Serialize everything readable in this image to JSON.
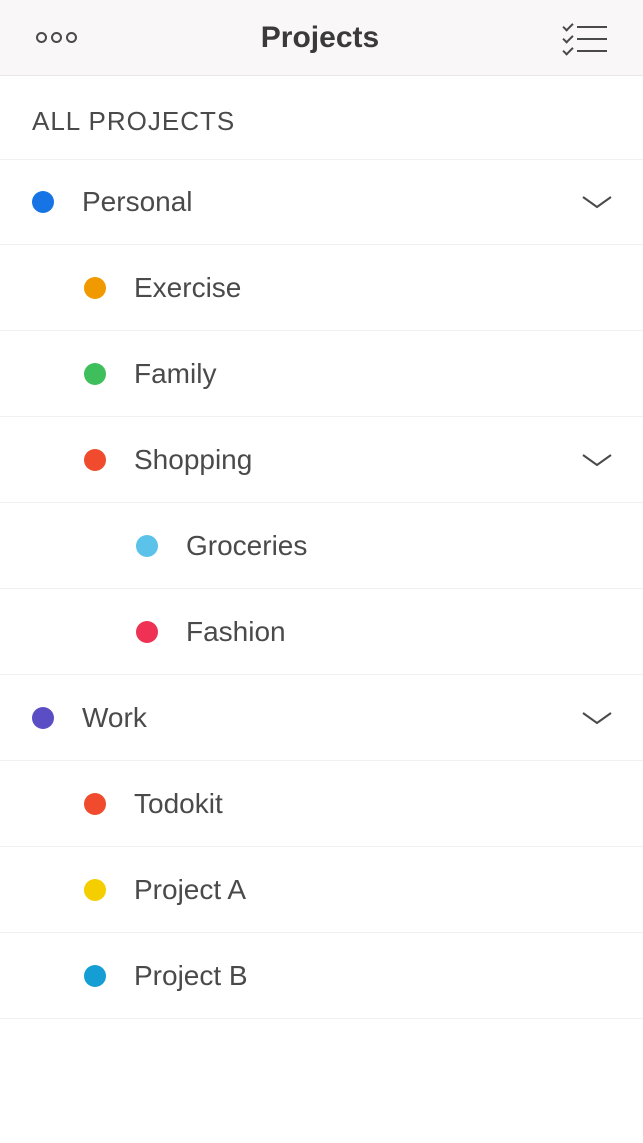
{
  "header": {
    "title": "Projects"
  },
  "sectionTitle": "ALL PROJECTS",
  "projects": [
    {
      "label": "Personal",
      "color": "#1674e5",
      "level": 0,
      "expandable": true
    },
    {
      "label": "Exercise",
      "color": "#f09a00",
      "level": 1,
      "expandable": false
    },
    {
      "label": "Family",
      "color": "#3fbf5c",
      "level": 1,
      "expandable": false
    },
    {
      "label": "Shopping",
      "color": "#ef4b2c",
      "level": 1,
      "expandable": true
    },
    {
      "label": "Groceries",
      "color": "#5bc3ea",
      "level": 2,
      "expandable": false
    },
    {
      "label": "Fashion",
      "color": "#ef3254",
      "level": 2,
      "expandable": false
    },
    {
      "label": "Work",
      "color": "#5b4ec5",
      "level": 0,
      "expandable": true
    },
    {
      "label": "Todokit",
      "color": "#ef4b2c",
      "level": 1,
      "expandable": false
    },
    {
      "label": "Project A",
      "color": "#f5ce00",
      "level": 1,
      "expandable": false
    },
    {
      "label": "Project B",
      "color": "#159ed4",
      "level": 1,
      "expandable": false
    }
  ]
}
